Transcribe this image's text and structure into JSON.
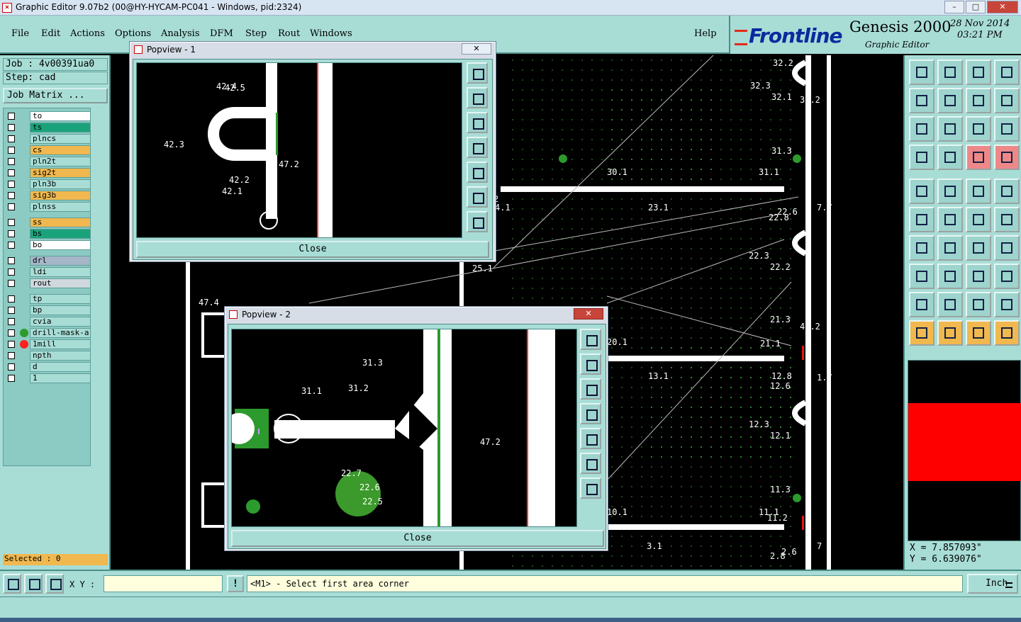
{
  "window": {
    "title": "Graphic Editor 9.07b2 (00@HY-HYCAM-PC041 - Windows, pid:2324)",
    "min": "–",
    "max": "□",
    "close": "✕"
  },
  "menu": [
    "File",
    "Edit",
    "Actions",
    "Options",
    "Analysis",
    "DFM",
    "Step",
    "Rout",
    "Windows"
  ],
  "help": "Help",
  "brand": {
    "logo": "Frontline",
    "product": "Genesis 2000",
    "subtitle": "Graphic Editor",
    "date": "28 Nov 2014",
    "time": "03:21 PM"
  },
  "job": {
    "job": "Job : 4v00391ua0",
    "step": "Step: cad",
    "matrix_button": "Job Matrix ..."
  },
  "layers": [
    {
      "name": "to",
      "color": "#ffffff"
    },
    {
      "name": "ts",
      "color": "#1aa37a"
    },
    {
      "name": "plncs",
      "color": "#a8ddd6"
    },
    {
      "name": "cs",
      "color": "#f0b84e"
    },
    {
      "name": "pln2t",
      "color": "#a8ddd6"
    },
    {
      "name": "sig2t",
      "color": "#f0b84e"
    },
    {
      "name": "pln3b",
      "color": "#a8ddd6"
    },
    {
      "name": "sig3b",
      "color": "#f0b84e"
    },
    {
      "name": "plnss",
      "color": "#a8ddd6"
    },
    {
      "name": "ss",
      "color": "#f0b84e"
    },
    {
      "name": "bs",
      "color": "#1aa37a"
    },
    {
      "name": "bo",
      "color": "#ffffff"
    },
    {
      "name": "drl",
      "color": "#a5b6c8"
    },
    {
      "name": "ldi",
      "color": "#a8ddd6"
    },
    {
      "name": "rout",
      "color": "#cfd8dd"
    },
    {
      "name": "tp",
      "color": "#a8ddd6"
    },
    {
      "name": "bp",
      "color": "#a8ddd6"
    },
    {
      "name": "cvia",
      "color": "#a8ddd6"
    },
    {
      "name": "drill-mask-a",
      "color": "#a8ddd6",
      "dot": "#2d9a2d"
    },
    {
      "name": "1mill",
      "color": "#a8ddd6",
      "dot": "#ff2020"
    },
    {
      "name": "npth",
      "color": "#a8ddd6"
    },
    {
      "name": "d",
      "color": "#a8ddd6"
    },
    {
      "name": "1",
      "color": "#a8ddd6"
    }
  ],
  "selected": "Selected : 0",
  "popview1": {
    "title": "Popview - 1",
    "close": "Close",
    "labels": [
      "42.4",
      "42.5",
      "42.3",
      "47.2",
      "42.2",
      "42.1"
    ]
  },
  "popview2": {
    "title": "Popview - 2",
    "close": "Close",
    "labels": [
      "31.3",
      "31.1",
      "31.2",
      "47.2",
      "22.7",
      "22.6",
      "22.5"
    ]
  },
  "canvas_labels": [
    "32.2",
    "32.3",
    "32.1",
    "32.2",
    "31.3",
    "30.1",
    "31.1",
    "23.1",
    "22.6",
    "22.8",
    "7.7",
    "22.3",
    "22.2",
    "25.1",
    "4.1",
    "47.4",
    "21.3",
    "47.2",
    "21.1",
    "20.1",
    "13.1",
    "12.6",
    "12.8",
    "1.7",
    "12.3",
    "12.1",
    "11.3",
    "11.1",
    "10.1",
    "11.2",
    "3.1",
    "2.6",
    "2.8",
    "7",
    "2"
  ],
  "coords": {
    "x": "X = 7.857093\"",
    "y": "Y = 6.639076\""
  },
  "status": {
    "xy_label": "X Y :",
    "xy_value": "",
    "warn": "!",
    "prompt": "<M1> - Select first area corner",
    "unit": "Inch"
  }
}
